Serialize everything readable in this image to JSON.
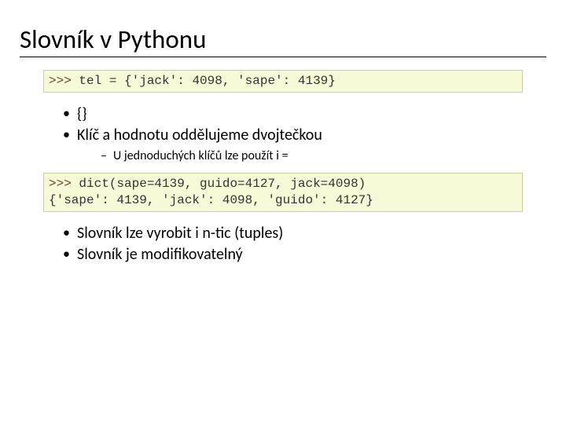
{
  "title": "Slovník v Pythonu",
  "code1": {
    "prompt": ">>>",
    "line": " tel = {'jack': 4098, 'sape': 4139}"
  },
  "bullets1": [
    "{}",
    "Klíč a hodnotu oddělujeme dvojtečkou"
  ],
  "subbullets1": [
    "U jednoduchých klíčů lze použít i ="
  ],
  "code2": {
    "prompt": ">>>",
    "line1": " dict(sape=4139, guido=4127, jack=4098)",
    "line2": "{'sape': 4139, 'jack': 4098, 'guido': 4127}"
  },
  "bullets2": [
    "Slovník lze vyrobit i n-tic (tuples)",
    "Slovník je modifikovatelný"
  ]
}
